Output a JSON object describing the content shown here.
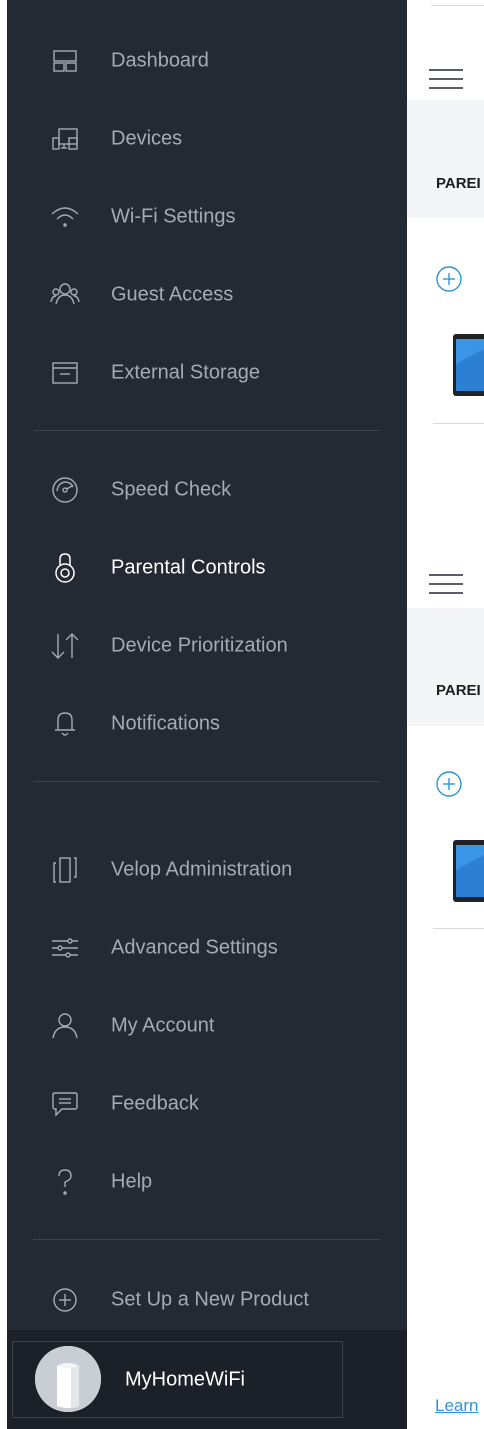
{
  "sidebar": {
    "items": [
      {
        "label": "Dashboard",
        "icon": "dashboard-icon"
      },
      {
        "label": "Devices",
        "icon": "devices-icon"
      },
      {
        "label": "Wi-Fi Settings",
        "icon": "wifi-icon"
      },
      {
        "label": "Guest Access",
        "icon": "guest-access-icon"
      },
      {
        "label": "External Storage",
        "icon": "storage-icon"
      },
      {
        "label": "Speed Check",
        "icon": "speedometer-icon"
      },
      {
        "label": "Parental Controls",
        "icon": "lock-icon",
        "active": true
      },
      {
        "label": "Device Prioritization",
        "icon": "priority-arrows-icon"
      },
      {
        "label": "Notifications",
        "icon": "bell-icon"
      },
      {
        "label": "Velop Administration",
        "icon": "velop-node-icon"
      },
      {
        "label": "Advanced Settings",
        "icon": "sliders-icon"
      },
      {
        "label": "My Account",
        "icon": "user-icon"
      },
      {
        "label": "Feedback",
        "icon": "chat-icon"
      },
      {
        "label": "Help",
        "icon": "question-icon"
      },
      {
        "label": "Set Up a New Product",
        "icon": "plus-circle-icon"
      }
    ],
    "network_name": "MyHomeWiFi"
  },
  "content": {
    "section_title_1": "PAREI",
    "section_title_2": "PAREI",
    "learn_link": "Learn"
  },
  "colors": {
    "sidebar_bg": "#232a34",
    "footer_bg": "#1b2029",
    "text_muted": "#a6abb2",
    "text_active": "#ffffff",
    "accent": "#2e96d6"
  }
}
